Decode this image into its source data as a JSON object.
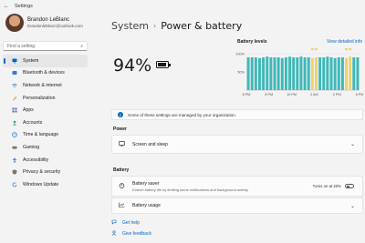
{
  "window": {
    "title": "Settings"
  },
  "profile": {
    "name": "Brandon LeBlanc",
    "email": "brandonleblanc@outlook.com"
  },
  "search": {
    "placeholder": "Find a setting"
  },
  "sidebar": {
    "items": [
      {
        "label": "System",
        "icon": "monitor-icon",
        "active": true
      },
      {
        "label": "Bluetooth & devices",
        "icon": "bluetooth-icon"
      },
      {
        "label": "Network & internet",
        "icon": "wifi-icon"
      },
      {
        "label": "Personalization",
        "icon": "brush-icon"
      },
      {
        "label": "Apps",
        "icon": "apps-icon"
      },
      {
        "label": "Accounts",
        "icon": "person-icon"
      },
      {
        "label": "Time & language",
        "icon": "globe-clock-icon"
      },
      {
        "label": "Gaming",
        "icon": "gamepad-icon"
      },
      {
        "label": "Accessibility",
        "icon": "accessibility-icon"
      },
      {
        "label": "Privacy & security",
        "icon": "shield-icon"
      },
      {
        "label": "Windows Update",
        "icon": "update-icon"
      }
    ]
  },
  "header": {
    "breadcrumb_parent": "System",
    "breadcrumb_sep": "›",
    "title": "Power & battery"
  },
  "battery": {
    "percent_label": "94%",
    "level": 0.94
  },
  "battery_levels": {
    "label": "Battery levels",
    "link": "View detailed info"
  },
  "chart_data": {
    "type": "bar",
    "title": "Battery levels",
    "ylim": [
      0,
      100
    ],
    "y_ticks": [
      "100%",
      "50%"
    ],
    "x_ticks": [
      "8 PM",
      "8 PM",
      "10 PM",
      "2 AM",
      "2 PM",
      "8 PM"
    ],
    "values": [
      90,
      90,
      90,
      88,
      90,
      92,
      90,
      90,
      90,
      88,
      90,
      92,
      90,
      90,
      92,
      90,
      90,
      88,
      90,
      90,
      90,
      92,
      90,
      88,
      90,
      90,
      88,
      92,
      90,
      90
    ],
    "bar_colors": [
      "teal",
      "teal",
      "teal",
      "teal",
      "teal",
      "teal",
      "teal",
      "teal",
      "teal",
      "teal",
      "teal",
      "teal",
      "teal",
      "teal",
      "teal",
      "teal",
      "teal",
      "yellow",
      "yellow",
      "teal",
      "teal",
      "teal",
      "teal",
      "teal",
      "teal",
      "teal",
      "yellow",
      "yellow",
      "teal",
      "teal"
    ],
    "colors": {
      "teal": "#3fb8b8",
      "yellow": "#ecd36f"
    }
  },
  "notice": {
    "text": "Some of these settings are managed by your organization."
  },
  "power": {
    "section_label": "Power",
    "screen_sleep": {
      "label": "Screen and sleep"
    }
  },
  "battery_section": {
    "section_label": "Battery",
    "saver": {
      "title": "Battery saver",
      "subtitle": "Extend battery life by limiting some notifications and background activity",
      "value": "Turns on at 20%"
    },
    "usage": {
      "label": "Battery usage"
    }
  },
  "links": {
    "help": "Get help",
    "feedback": "Give feedback"
  },
  "colors": {
    "accent": "#0067c0",
    "chart_teal": "#3fb8b8",
    "chart_yellow": "#ecd36f"
  }
}
